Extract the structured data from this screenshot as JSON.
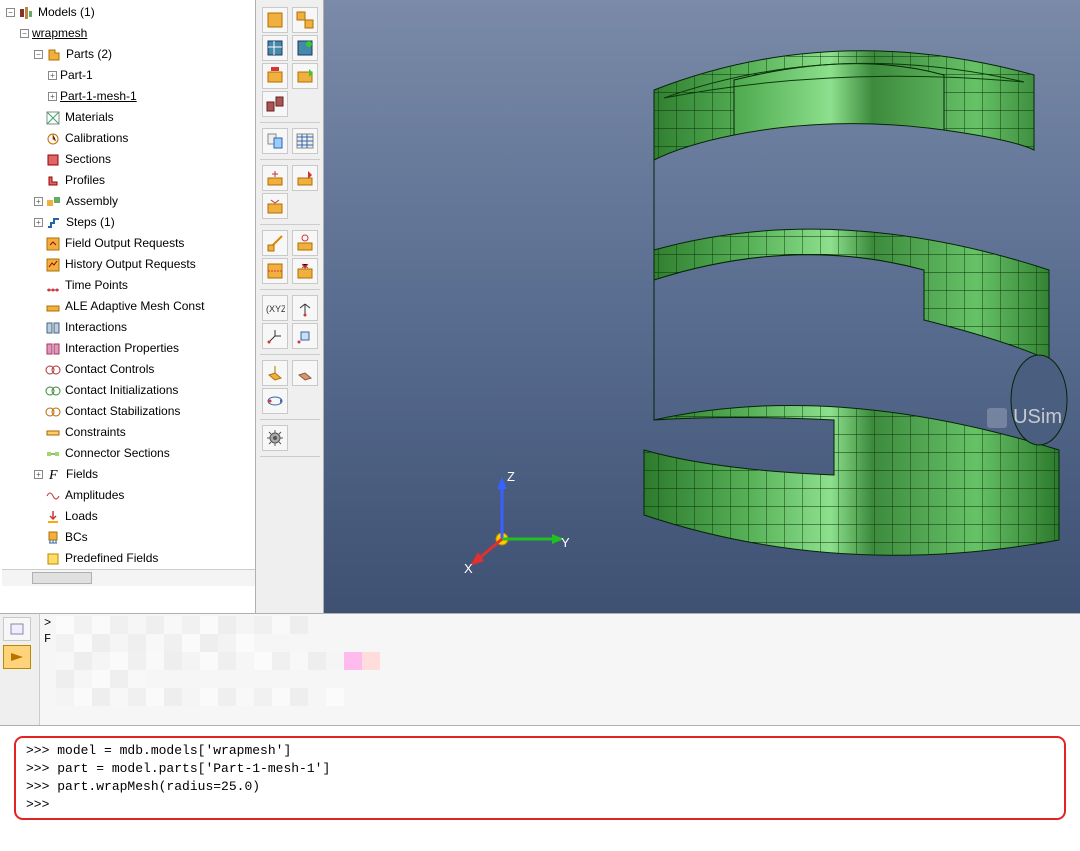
{
  "tree": {
    "root": {
      "label": "Models (1)",
      "icon": "models",
      "expander": "−"
    },
    "model": {
      "label": "wrapmesh",
      "expander": "−"
    },
    "items": [
      {
        "label": "Parts (2)",
        "icon": "parts",
        "expander": "−",
        "children": [
          {
            "label": "Part-1",
            "expander": "+"
          },
          {
            "label": "Part-1-mesh-1",
            "expander": "+",
            "underline": true
          }
        ]
      },
      {
        "label": "Materials",
        "icon": "materials"
      },
      {
        "label": "Calibrations",
        "icon": "calibrations"
      },
      {
        "label": "Sections",
        "icon": "sections"
      },
      {
        "label": "Profiles",
        "icon": "profiles"
      },
      {
        "label": "Assembly",
        "icon": "assembly",
        "expander": "+"
      },
      {
        "label": "Steps (1)",
        "icon": "steps",
        "expander": "+"
      },
      {
        "label": "Field Output Requests",
        "icon": "field-output"
      },
      {
        "label": "History Output Requests",
        "icon": "history-output"
      },
      {
        "label": "Time Points",
        "icon": "time-points"
      },
      {
        "label": "ALE Adaptive Mesh Const",
        "icon": "ale"
      },
      {
        "label": "Interactions",
        "icon": "interactions"
      },
      {
        "label": "Interaction Properties",
        "icon": "interaction-props"
      },
      {
        "label": "Contact Controls",
        "icon": "contact-controls"
      },
      {
        "label": "Contact Initializations",
        "icon": "contact-init"
      },
      {
        "label": "Contact Stabilizations",
        "icon": "contact-stab"
      },
      {
        "label": "Constraints",
        "icon": "constraints"
      },
      {
        "label": "Connector Sections",
        "icon": "connector"
      },
      {
        "label": "Fields",
        "icon": "fields",
        "expander": "+"
      },
      {
        "label": "Amplitudes",
        "icon": "amplitudes"
      },
      {
        "label": "Loads",
        "icon": "loads"
      },
      {
        "label": "BCs",
        "icon": "bcs"
      },
      {
        "label": "Predefined Fields",
        "icon": "predef"
      }
    ]
  },
  "triad": {
    "x": "X",
    "y": "Y",
    "z": "Z"
  },
  "watermark": "USim",
  "console": {
    "prompt": ">>> ",
    "lines": [
      "model = mdb.models['wrapmesh']",
      "part = model.parts['Part-1-mesh-1']",
      "part.wrapMesh(radius=25.0)",
      ""
    ]
  },
  "message_prefix1": ">",
  "message_prefix2": "F",
  "toolbox_groups": [
    [
      [
        "create-part",
        "part-manager"
      ],
      [
        "part-attributes",
        "part-display"
      ],
      [
        "part-1",
        "part-2"
      ],
      [
        "part-assembly",
        null
      ]
    ],
    [
      [
        "query",
        "reference"
      ]
    ],
    [
      [
        "datum-plane",
        "datum-axis"
      ],
      [
        "datum-csys",
        null
      ]
    ],
    [
      [
        "partition-face",
        "partition-edge"
      ],
      [
        "partition-cell",
        "partition-cut"
      ]
    ],
    [
      [
        "xyz-label",
        "csys-pick"
      ],
      [
        "csys-edit",
        "csys-point"
      ]
    ],
    [
      [
        "color-code",
        "wire"
      ],
      [
        "rotate-view",
        null
      ]
    ],
    [
      [
        "settings",
        null
      ]
    ]
  ]
}
